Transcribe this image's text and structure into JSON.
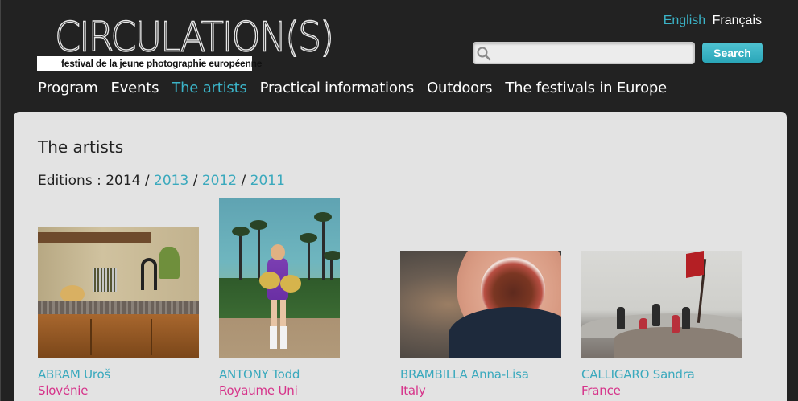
{
  "logo": {
    "title": "CIRCULATION(S)",
    "tagline": "festival de la jeune photographie européenne"
  },
  "lang": {
    "english": "English",
    "francais": "Français"
  },
  "search": {
    "placeholder": "",
    "value": "",
    "button_label": "Search"
  },
  "nav": [
    {
      "label": "Program",
      "active": false
    },
    {
      "label": "Events",
      "active": false
    },
    {
      "label": "The artists",
      "active": true
    },
    {
      "label": "Practical informations",
      "active": false
    },
    {
      "label": "Outdoors",
      "active": false
    },
    {
      "label": "The festivals in Europe",
      "active": false
    }
  ],
  "page": {
    "title": "The artists",
    "editions_label": "Editions : ",
    "editions": [
      "2014",
      "2013",
      "2012",
      "2011"
    ],
    "current_edition": "2014"
  },
  "artists": [
    {
      "name": "ABRAM Uroš",
      "country": "Slovénie"
    },
    {
      "name": "ANTONY Todd",
      "country": "Royaume Uni"
    },
    {
      "name": "BRAMBILLA Anna-Lisa",
      "country": "Italy"
    },
    {
      "name": "CALLIGARO Sandra",
      "country": "France"
    }
  ],
  "colors": {
    "background": "#222222",
    "panel": "#e3e3e3",
    "accent": "#3bb4c8",
    "country": "#d6338a"
  }
}
